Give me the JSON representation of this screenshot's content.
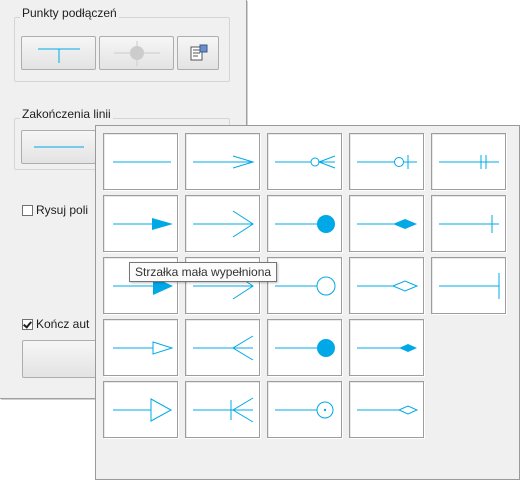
{
  "dialog": {
    "connection_points_title": "Punkty podłączeń",
    "line_endings_title": "Zakończenia linii",
    "draw_polyline_label": "Rysuj poli",
    "end_auto_label": "Kończ aut",
    "end_auto_checked": true,
    "draw_polyline_checked": false
  },
  "palette": {
    "line_color": "#00a8e8",
    "cells": [
      "plain-line",
      "open-arrow-small",
      "crow-foot-circle",
      "circle-bar",
      "double-bar",
      "filled-arrow-small",
      "open-arrow-large",
      "filled-circle-large",
      "filled-diamond",
      "single-bar",
      "filled-arrow-large",
      "open-arrow-large-2",
      "open-circle-large",
      "open-diamond",
      "end-bar",
      "hollow-triangle-small",
      "crow-foot",
      "filled-circle",
      "filled-diamond-small",
      "hollow-triangle-large",
      "bar-crow-foot",
      "small-circle",
      "small-open-diamond"
    ]
  },
  "tooltip": {
    "text": "Strzałka mała wypełniona"
  }
}
